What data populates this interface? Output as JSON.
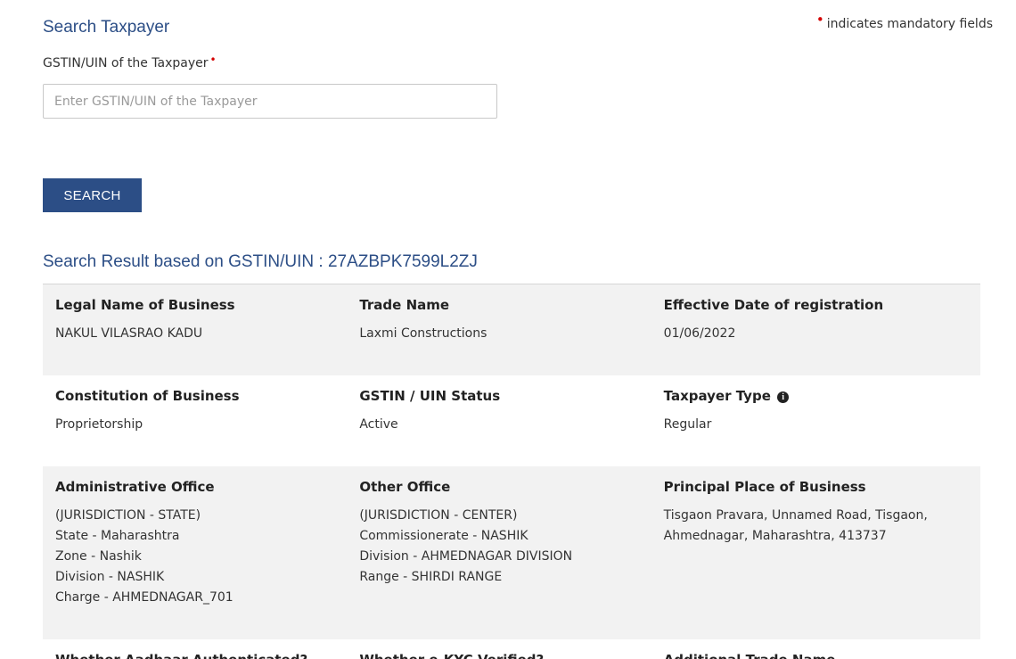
{
  "header": {
    "title": "Search Taxpayer",
    "mandatory_note": "indicates mandatory fields",
    "mandatory_marker": "•"
  },
  "search": {
    "label": "GSTIN/UIN of the Taxpayer",
    "required_marker": "•",
    "placeholder": "Enter GSTIN/UIN of the Taxpayer",
    "value": "",
    "button_label": "SEARCH"
  },
  "result": {
    "title": "Search Result based on GSTIN/UIN : 27AZBPK7599L2ZJ",
    "rows": [
      [
        {
          "label": "Legal Name of Business",
          "lines": [
            "NAKUL VILASRAO KADU"
          ]
        },
        {
          "label": "Trade Name",
          "lines": [
            "Laxmi Constructions"
          ]
        },
        {
          "label": "Effective Date of registration",
          "lines": [
            "01/06/2022"
          ]
        }
      ],
      [
        {
          "label": "Constitution of Business",
          "lines": [
            "Proprietorship"
          ]
        },
        {
          "label": "GSTIN / UIN Status",
          "lines": [
            "Active"
          ]
        },
        {
          "label": "Taxpayer Type",
          "lines": [
            "Regular"
          ],
          "info_icon": "i"
        }
      ],
      [
        {
          "label": "Administrative Office",
          "lines": [
            "(JURISDICTION - STATE)",
            "State - Maharashtra",
            "Zone - Nashik",
            "Division - NASHIK",
            "Charge - AHMEDNAGAR_701"
          ]
        },
        {
          "label": "Other Office",
          "lines": [
            "(JURISDICTION - CENTER)",
            "Commissionerate - NASHIK",
            "Division - AHMEDNAGAR DIVISION",
            "Range - SHIRDI RANGE"
          ]
        },
        {
          "label": "Principal Place of Business",
          "lines": [
            "Tisgaon Pravara, Unnamed Road, Tisgaon,",
            "Ahmednagar, Maharashtra, 413737"
          ]
        }
      ],
      [
        {
          "label": "Whether Aadhaar Authenticated?",
          "lines": []
        },
        {
          "label": "Whether e-KYC Verified?",
          "lines": []
        },
        {
          "label": "Additional Trade Name",
          "lines": []
        }
      ]
    ]
  },
  "colors": {
    "primary": "#2c4e86",
    "required": "#d40000",
    "row_shade": "#f2f2f2"
  }
}
